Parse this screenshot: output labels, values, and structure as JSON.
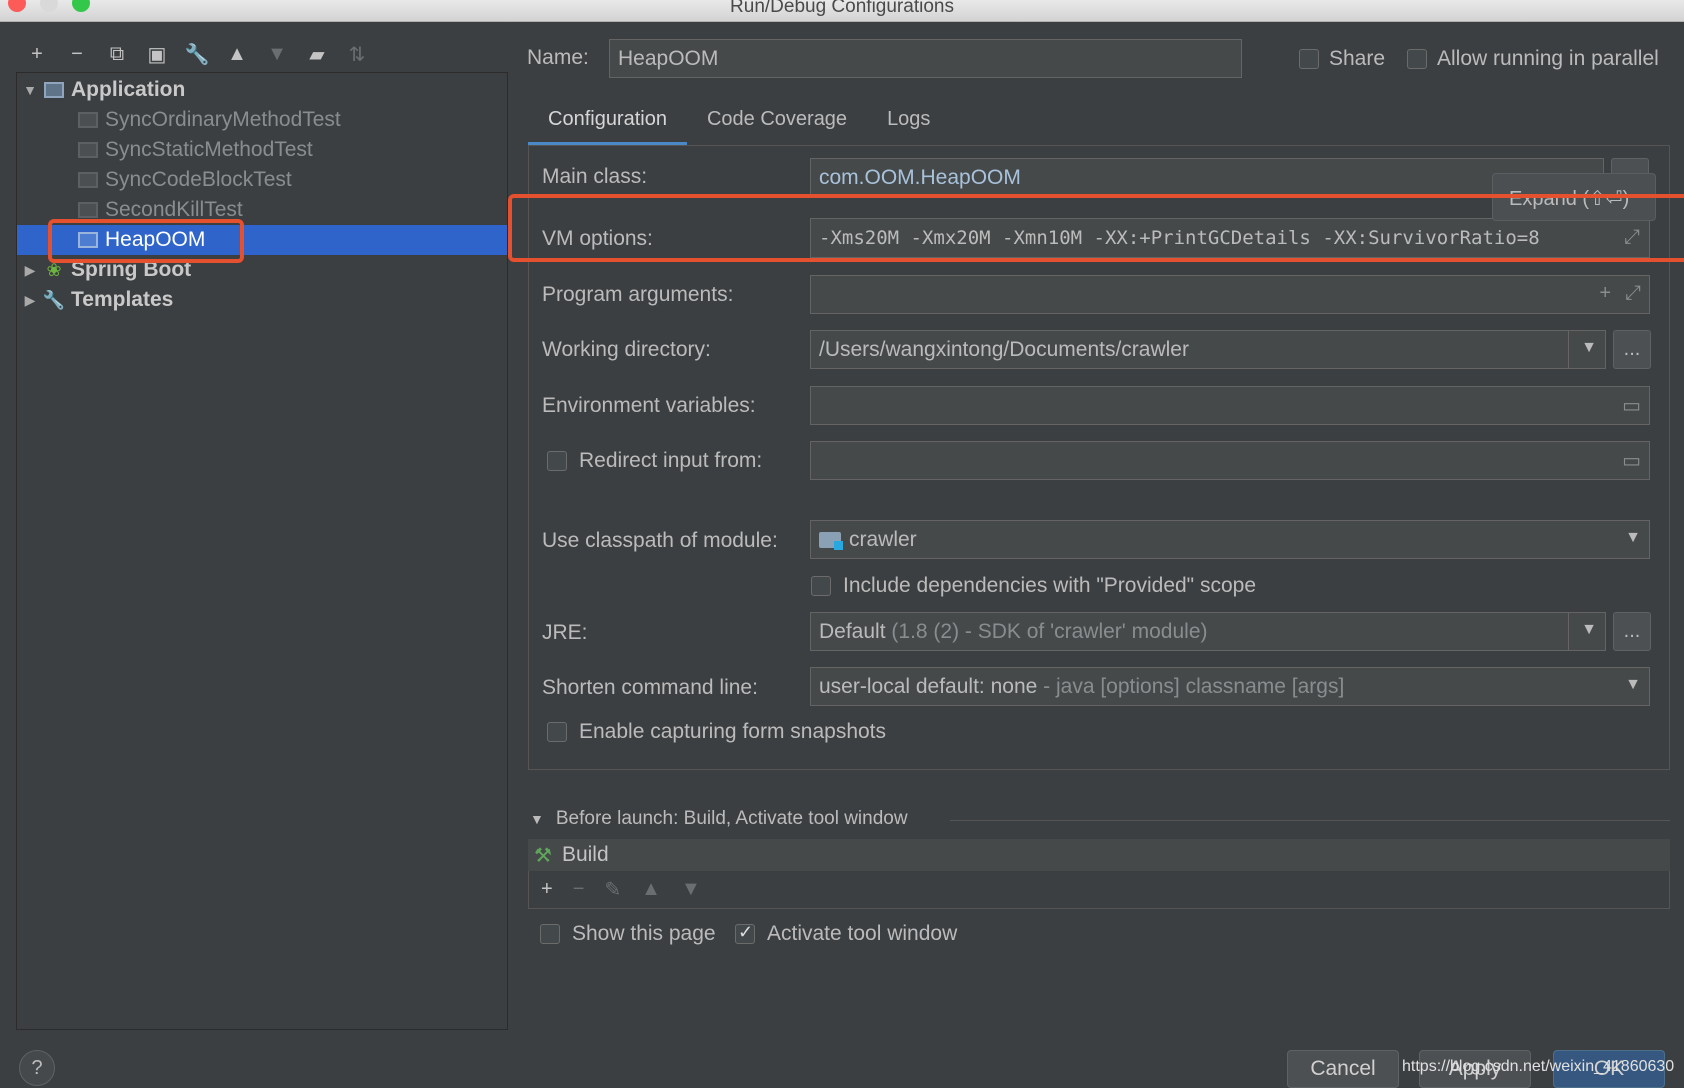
{
  "window": {
    "title": "Run/Debug Configurations"
  },
  "toolbar": {
    "icons": [
      "plus-icon",
      "minus-icon",
      "copy-icon",
      "save-icon",
      "wrench-icon",
      "arrow-up-icon",
      "arrow-down-icon",
      "folder-add-icon",
      "sort-icon"
    ]
  },
  "tree": {
    "application": "Application",
    "items": [
      "SyncOrdinaryMethodTest",
      "SyncStaticMethodTest",
      "SyncCodeBlockTest",
      "SecondKillTest",
      "HeapOOM"
    ],
    "selected": "HeapOOM",
    "spring_boot": "Spring Boot",
    "templates": "Templates"
  },
  "header": {
    "name_label": "Name:",
    "name_value": "HeapOOM",
    "share_label": "Share",
    "parallel_label": "Allow running in parallel"
  },
  "tabs": [
    "Configuration",
    "Code Coverage",
    "Logs"
  ],
  "form": {
    "main_class_label": "Main class:",
    "main_class_value": "com.OOM.HeapOOM",
    "vm_options_label": "VM options:",
    "vm_options_value": "-Xms20M -Xmx20M -Xmn10M -XX:+PrintGCDetails -XX:SurvivorRatio=8",
    "expand_tooltip": "Expand (⇧⏎)",
    "program_args_label": "Program arguments:",
    "working_dir_label": "Working directory:",
    "working_dir_value": "/Users/wangxintong/Documents/crawler",
    "env_vars_label": "Environment variables:",
    "redirect_label": "Redirect input from:",
    "classpath_label": "Use classpath of module:",
    "classpath_value": "crawler",
    "include_deps_label": "Include dependencies with \"Provided\" scope",
    "jre_label": "JRE:",
    "jre_value": "Default",
    "jre_hint": "(1.8 (2) - SDK of 'crawler' module)",
    "shorten_label": "Shorten command line:",
    "shorten_value": "user-local default: none",
    "shorten_hint": "- java [options] classname [args]",
    "snapshots_label": "Enable capturing form snapshots",
    "ellipsis": "..."
  },
  "before_launch": {
    "title": "Before launch: Build, Activate tool window",
    "build_label": "Build",
    "show_page_label": "Show this page",
    "activate_label": "Activate tool window"
  },
  "buttons": {
    "help": "?",
    "cancel": "Cancel",
    "apply": "Apply",
    "ok": "OK"
  },
  "watermark": "https://blog.csdn.net/weixin_41860630",
  "colors": {
    "highlight": "#e5502f",
    "selection": "#2f65ca",
    "accent": "#4a88c7"
  }
}
